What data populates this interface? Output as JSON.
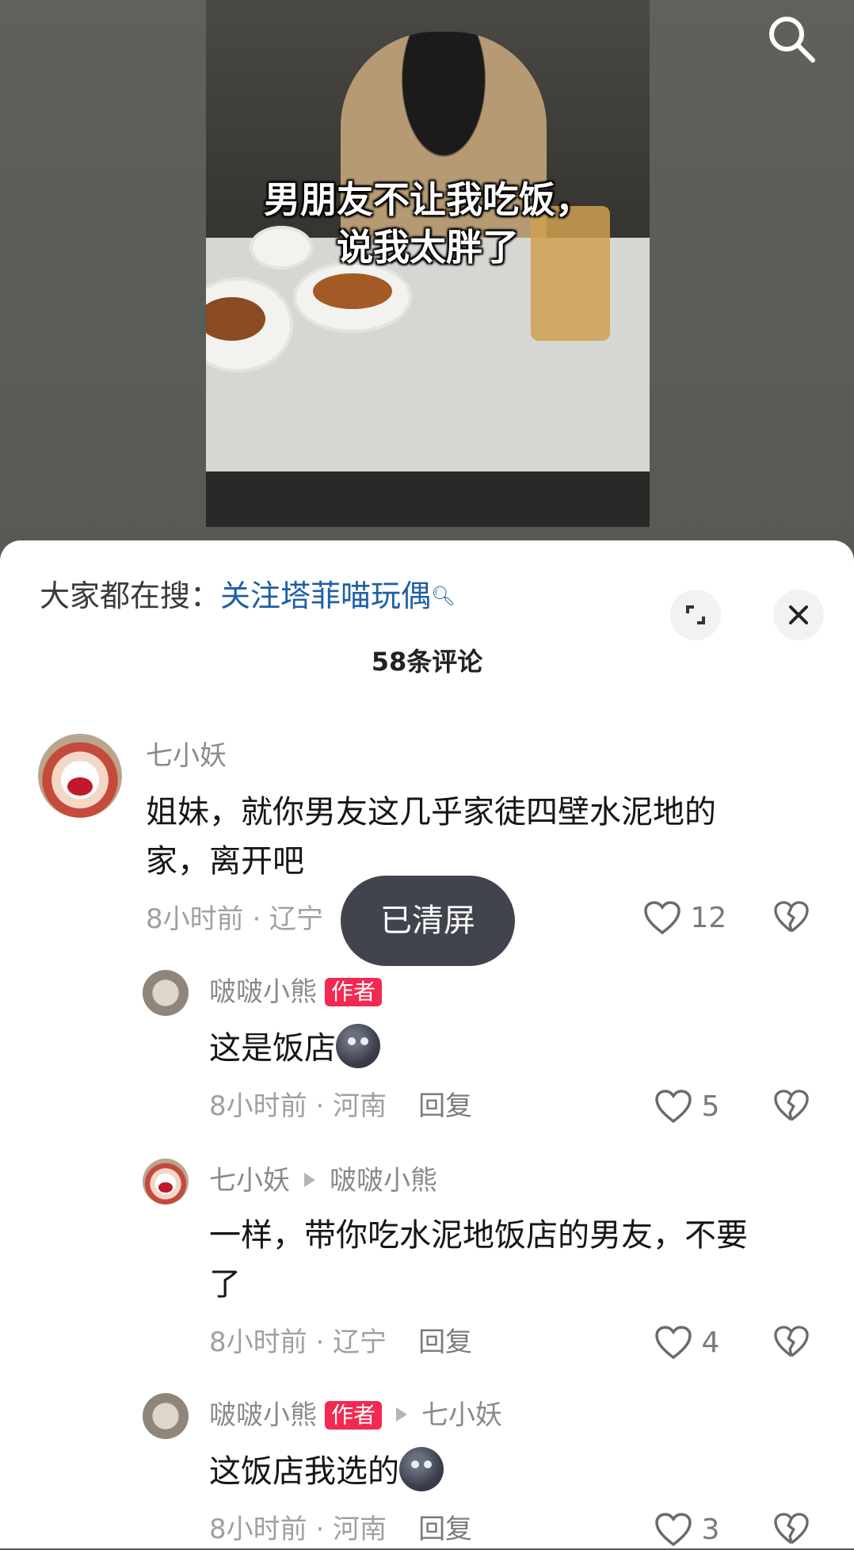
{
  "video": {
    "caption_line1": "男朋友不让我吃饭，",
    "caption_line2": "说我太胖了"
  },
  "panel": {
    "hot_search_prefix": "大家都在搜：",
    "hot_search_term": "关注塔菲喵玩偶",
    "comment_count": "58条评论"
  },
  "comments": [
    {
      "user": "七小妖",
      "text_line1": "姐妹，就你男友这几乎家徒四壁水泥地的",
      "text_line2": "家，离开吧",
      "meta": "8小时前 · 辽宁",
      "likes": "12"
    },
    {
      "user": "啵啵小熊",
      "badge": "作者",
      "text": "这是饭店",
      "meta": "8小时前 · 河南",
      "reply": "回复",
      "likes": "5"
    },
    {
      "user": "七小妖",
      "reply_to": "啵啵小熊",
      "text_line1": "一样，带你吃水泥地饭店的男友，不要",
      "text_line2": "了",
      "meta": "8小时前 · 辽宁",
      "reply": "回复",
      "likes": "4"
    },
    {
      "user": "啵啵小熊",
      "badge": "作者",
      "reply_to": "七小妖",
      "text": "这饭店我选的",
      "meta": "8小时前 · 河南",
      "reply": "回复",
      "likes": "3"
    }
  ],
  "toast": "已清屏"
}
